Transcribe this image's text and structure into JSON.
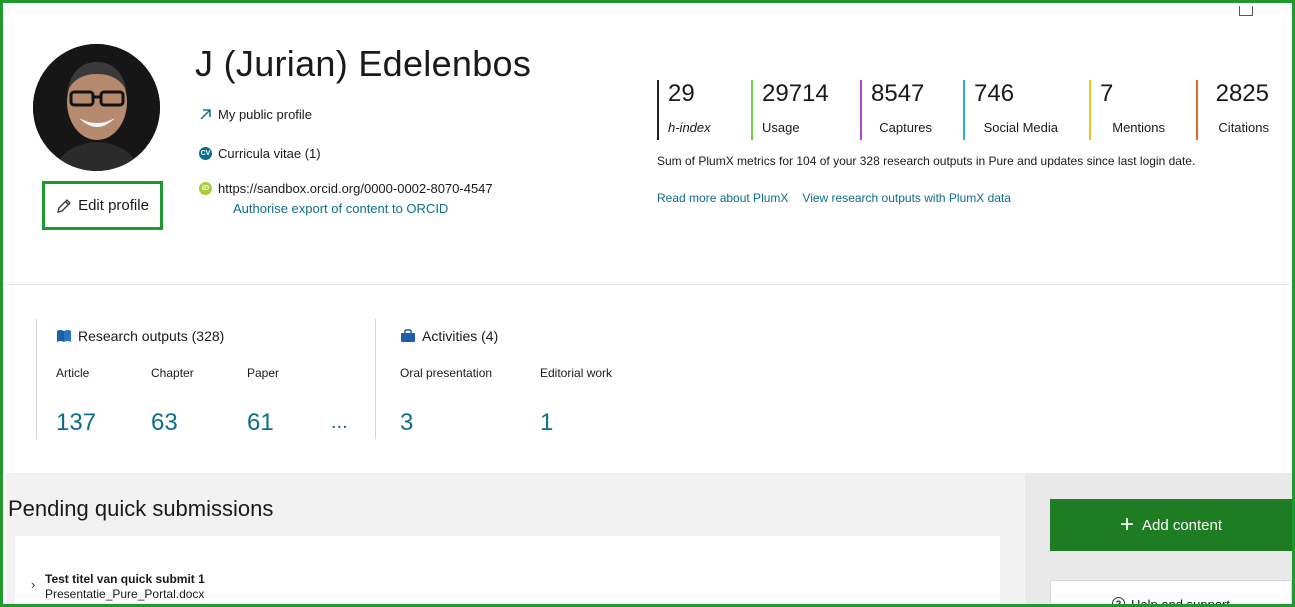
{
  "profile": {
    "name": "J (Jurian) Edelenbos",
    "public_profile_label": "My public profile",
    "cv_badge": "CV",
    "cv_label": "Curricula vitae (1)",
    "orcid_badge": "iD",
    "orcid_url": "https://sandbox.orcid.org/0000-0002-8070-4547",
    "authorise_label": "Authorise export of content to ORCID",
    "edit_label": "Edit profile"
  },
  "metrics": [
    {
      "value": "29",
      "label": "h-index",
      "color": "#222222"
    },
    {
      "value": "29714",
      "label": "Usage",
      "color": "#6fcf3f"
    },
    {
      "value": "8547",
      "label": "Captures",
      "color": "#b04ad6"
    },
    {
      "value": "746",
      "label": "Social Media",
      "color": "#2ab0d6"
    },
    {
      "value": "7",
      "label": "Mentions",
      "color": "#f0c020"
    },
    {
      "value": "2825",
      "label": "Citations",
      "color": "#e8661e"
    }
  ],
  "plumx": {
    "note": "Sum of PlumX metrics for 104 of your 328 research outputs in Pure and updates since last login date.",
    "read_more": "Read more about PlumX",
    "view_outputs": "View research outputs with PlumX data"
  },
  "research_outputs": {
    "title": "Research outputs (328)",
    "columns": [
      {
        "label": "Article",
        "value": "137"
      },
      {
        "label": "Chapter",
        "value": "63"
      },
      {
        "label": "Paper",
        "value": "61"
      }
    ],
    "more": "..."
  },
  "activities": {
    "title": "Activities (4)",
    "columns": [
      {
        "label": "Oral presentation",
        "value": "3"
      },
      {
        "label": "Editorial work",
        "value": "1"
      }
    ]
  },
  "pending": {
    "title": "Pending quick submissions",
    "items": [
      {
        "title": "Test titel van quick submit 1",
        "file": "Presentatie_Pure_Portal.docx"
      }
    ]
  },
  "sidebar": {
    "add_content": "Add content",
    "help": "Help and support"
  },
  "colors": {
    "accent_green": "#1e7d23",
    "link_teal": "#0d6e8c",
    "highlight_green": "#1f9a2e"
  }
}
